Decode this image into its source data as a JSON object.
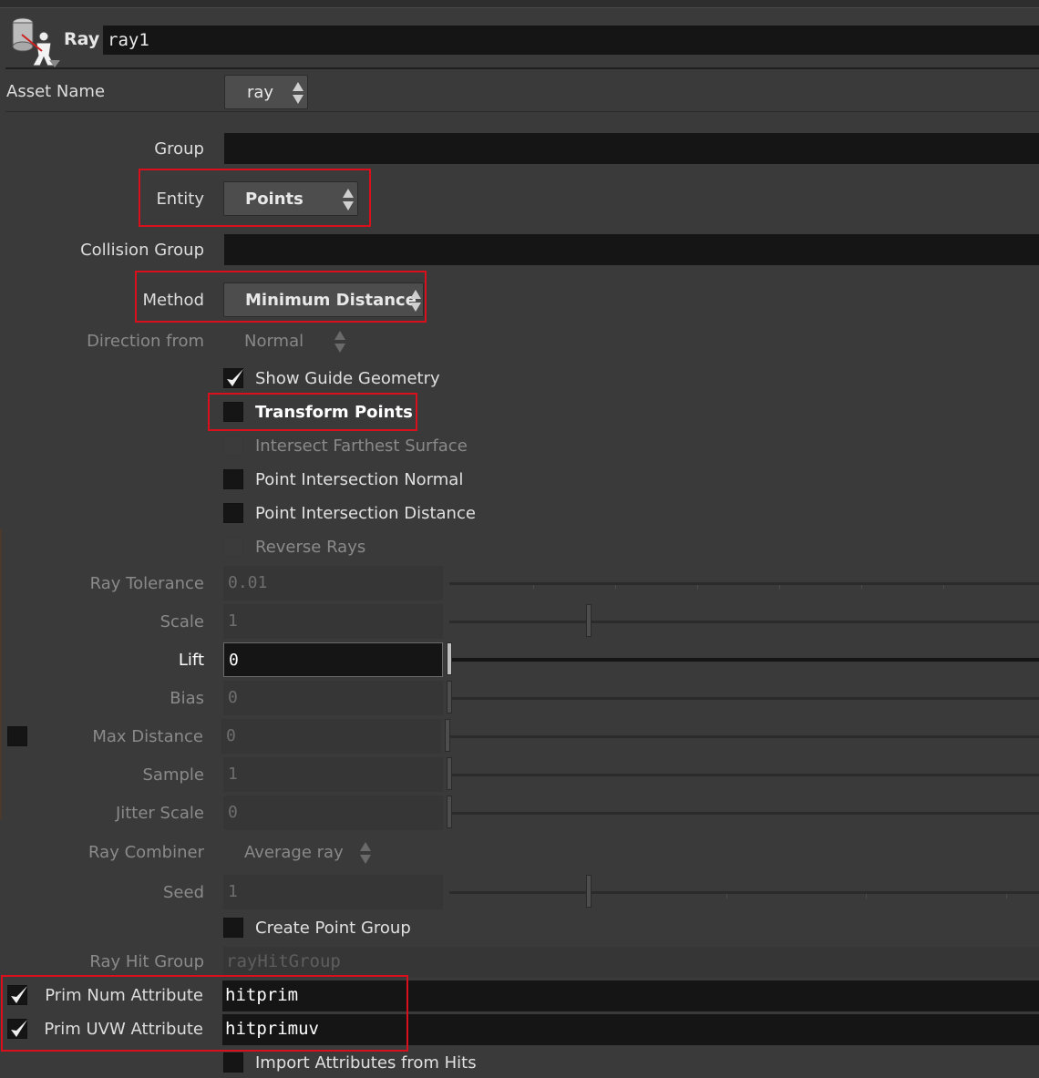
{
  "header": {
    "op_label": "Ray",
    "node_name": "ray1",
    "icon": "ray-sop-icon"
  },
  "asset_name": {
    "label": "Asset Name",
    "value": "ray"
  },
  "params": {
    "group": {
      "label": "Group",
      "value": ""
    },
    "entity": {
      "label": "Entity",
      "value": "Points"
    },
    "collision_group": {
      "label": "Collision Group",
      "value": ""
    },
    "method": {
      "label": "Method",
      "value": "Minimum Distance"
    },
    "direction_from": {
      "label": "Direction from",
      "value": "Normal"
    },
    "show_guide": {
      "label": "Show Guide Geometry",
      "checked": true
    },
    "transform_points": {
      "label": "Transform Points",
      "checked": false
    },
    "intersect_farthest": {
      "label": "Intersect Farthest Surface",
      "checked": false
    },
    "point_int_normal": {
      "label": "Point Intersection Normal",
      "checked": false
    },
    "point_int_distance": {
      "label": "Point Intersection Distance",
      "checked": false
    },
    "reverse_rays": {
      "label": "Reverse Rays",
      "checked": false
    },
    "ray_tolerance": {
      "label": "Ray Tolerance",
      "value": "0.01"
    },
    "scale": {
      "label": "Scale",
      "value": "1"
    },
    "lift": {
      "label": "Lift",
      "value": "0"
    },
    "bias": {
      "label": "Bias",
      "value": "0"
    },
    "max_distance": {
      "label": "Max Distance",
      "value": "0"
    },
    "sample": {
      "label": "Sample",
      "value": "1"
    },
    "jitter_scale": {
      "label": "Jitter Scale",
      "value": "0"
    },
    "ray_combiner": {
      "label": "Ray Combiner",
      "value": "Average ray"
    },
    "seed": {
      "label": "Seed",
      "value": "1"
    },
    "create_point_group": {
      "label": "Create Point Group",
      "checked": false
    },
    "ray_hit_group": {
      "label": "Ray Hit Group",
      "value": "rayHitGroup"
    },
    "prim_num_attr": {
      "label": "Prim Num Attribute",
      "value": "hitprim",
      "checked": true
    },
    "prim_uvw_attr": {
      "label": "Prim UVW Attribute",
      "value": "hitprimuv",
      "checked": true
    },
    "import_attrs": {
      "label": "Import Attributes from Hits",
      "checked": false
    }
  },
  "colors": {
    "highlight": "#d9101b",
    "panel_bg": "#3a3a3a",
    "field_bg": "#151515"
  }
}
